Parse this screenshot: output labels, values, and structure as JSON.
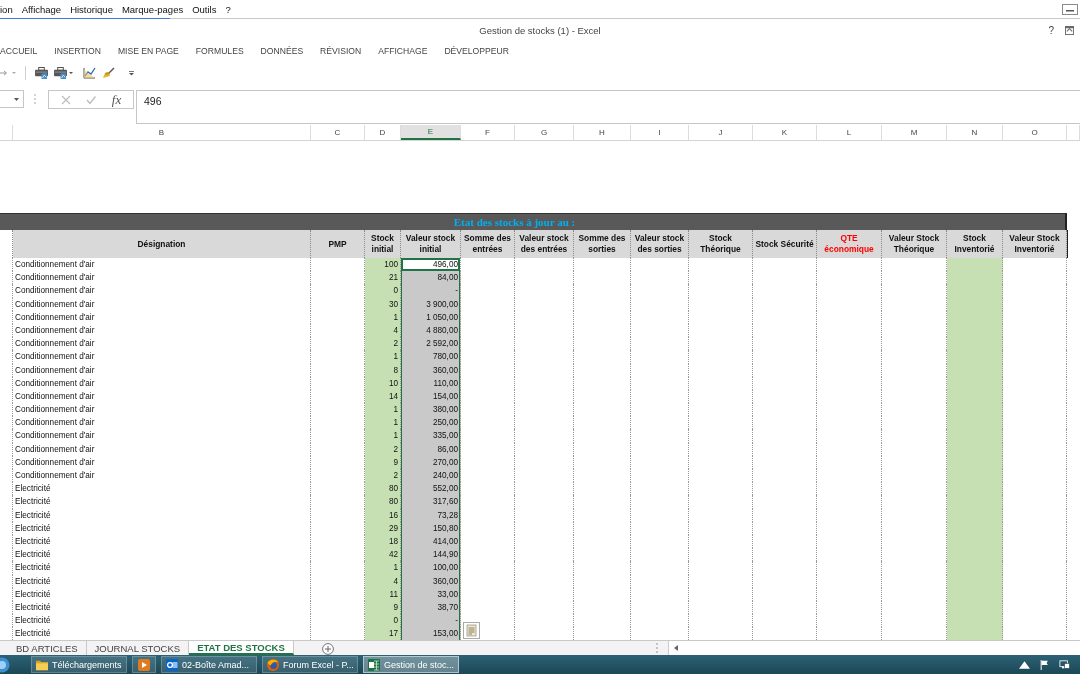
{
  "browser_menu": [
    "ion",
    "Affichage",
    "Historique",
    "Marque-pages",
    "Outils",
    "?"
  ],
  "window": {
    "title": "Gestion de stocks (1) - Excel",
    "help": "?"
  },
  "ribbon_tabs": [
    "ACCUEIL",
    "INSERTION",
    "MISE EN PAGE",
    "FORMULES",
    "DONNÉES",
    "RÉVISION",
    "AFFICHAGE",
    "DÉVELOPPEUR"
  ],
  "formula_bar": {
    "function_button": "fx",
    "value": "496"
  },
  "sheet": {
    "banner": "Etat des stocks à jour au :",
    "columns": [
      {
        "letter": "B",
        "label": "Désignation",
        "selected": false,
        "emphasized": false
      },
      {
        "letter": "C",
        "label": "PMP",
        "selected": false,
        "emphasized": false
      },
      {
        "letter": "D",
        "label": "Stock initial",
        "selected": false,
        "emphasized": false,
        "color": "#c6e0b4"
      },
      {
        "letter": "E",
        "label": "Valeur stock initial",
        "selected": true,
        "emphasized": false,
        "color": "#c9c9c9"
      },
      {
        "letter": "F",
        "label": "Somme des entrées",
        "selected": false,
        "emphasized": false
      },
      {
        "letter": "G",
        "label": "Valeur stock des entrées",
        "selected": false,
        "emphasized": false
      },
      {
        "letter": "H",
        "label": "Somme des sorties",
        "selected": false,
        "emphasized": false
      },
      {
        "letter": "I",
        "label": "Valeur stock des sorties",
        "selected": false,
        "emphasized": false
      },
      {
        "letter": "J",
        "label": "Stock Théorique",
        "selected": false,
        "emphasized": false
      },
      {
        "letter": "K",
        "label": "Stock Sécurité",
        "selected": false,
        "emphasized": false
      },
      {
        "letter": "L",
        "label": "QTE économique",
        "selected": false,
        "emphasized": true
      },
      {
        "letter": "M",
        "label": "Valeur Stock Théorique",
        "selected": false,
        "emphasized": false
      },
      {
        "letter": "N",
        "label": "Stock Inventorié",
        "selected": false,
        "emphasized": false,
        "color": "#c6e0b4"
      },
      {
        "letter": "O",
        "label": "Valeur Stock Inventorié",
        "selected": false,
        "emphasized": false
      }
    ],
    "rows": [
      {
        "designation": "Conditionnement d'air",
        "stock_initial": "100",
        "valeur_stock_initial": "496,00",
        "selected": true
      },
      {
        "designation": "Conditionnement d'air",
        "stock_initial": "21",
        "valeur_stock_initial": "84,00",
        "selected": false
      },
      {
        "designation": "Conditionnement d'air",
        "stock_initial": "0",
        "valeur_stock_initial": "-",
        "selected": false
      },
      {
        "designation": "Conditionnement d'air",
        "stock_initial": "30",
        "valeur_stock_initial": "3 900,00",
        "selected": false
      },
      {
        "designation": "Conditionnement d'air",
        "stock_initial": "1",
        "valeur_stock_initial": "1 050,00",
        "selected": false
      },
      {
        "designation": "Conditionnement d'air",
        "stock_initial": "4",
        "valeur_stock_initial": "4 880,00",
        "selected": false
      },
      {
        "designation": "Conditionnement d'air",
        "stock_initial": "2",
        "valeur_stock_initial": "2 592,00",
        "selected": false
      },
      {
        "designation": "Conditionnement d'air",
        "stock_initial": "1",
        "valeur_stock_initial": "780,00",
        "selected": false
      },
      {
        "designation": "Conditionnement d'air",
        "stock_initial": "8",
        "valeur_stock_initial": "360,00",
        "selected": false
      },
      {
        "designation": "Conditionnement d'air",
        "stock_initial": "10",
        "valeur_stock_initial": "110,00",
        "selected": false
      },
      {
        "designation": "Conditionnement d'air",
        "stock_initial": "14",
        "valeur_stock_initial": "154,00",
        "selected": false
      },
      {
        "designation": "Conditionnement d'air",
        "stock_initial": "1",
        "valeur_stock_initial": "380,00",
        "selected": false
      },
      {
        "designation": "Conditionnement d'air",
        "stock_initial": "1",
        "valeur_stock_initial": "250,00",
        "selected": false
      },
      {
        "designation": "Conditionnement d'air",
        "stock_initial": "1",
        "valeur_stock_initial": "335,00",
        "selected": false
      },
      {
        "designation": "Conditionnement d'air",
        "stock_initial": "2",
        "valeur_stock_initial": "86,00",
        "selected": false
      },
      {
        "designation": "Conditionnement d'air",
        "stock_initial": "9",
        "valeur_stock_initial": "270,00",
        "selected": false
      },
      {
        "designation": "Conditionnement d'air",
        "stock_initial": "2",
        "valeur_stock_initial": "240,00",
        "selected": false
      },
      {
        "designation": "Electricité",
        "stock_initial": "80",
        "valeur_stock_initial": "552,00",
        "selected": false
      },
      {
        "designation": "Electricité",
        "stock_initial": "80",
        "valeur_stock_initial": "317,60",
        "selected": false
      },
      {
        "designation": "Electricité",
        "stock_initial": "16",
        "valeur_stock_initial": "73,28",
        "selected": false
      },
      {
        "designation": "Electricité",
        "stock_initial": "29",
        "valeur_stock_initial": "150,80",
        "selected": false
      },
      {
        "designation": "Electricité",
        "stock_initial": "18",
        "valeur_stock_initial": "414,00",
        "selected": false
      },
      {
        "designation": "Electricité",
        "stock_initial": "42",
        "valeur_stock_initial": "144,90",
        "selected": false
      },
      {
        "designation": "Electricité",
        "stock_initial": "1",
        "valeur_stock_initial": "100,00",
        "selected": false
      },
      {
        "designation": "Electricité",
        "stock_initial": "4",
        "valeur_stock_initial": "360,00",
        "selected": false
      },
      {
        "designation": "Electricité",
        "stock_initial": "11",
        "valeur_stock_initial": "33,00",
        "selected": false
      },
      {
        "designation": "Electricité",
        "stock_initial": "9",
        "valeur_stock_initial": "38,70",
        "selected": false
      },
      {
        "designation": "Electricité",
        "stock_initial": "0",
        "valeur_stock_initial": "-",
        "selected": false
      },
      {
        "designation": "Electricité",
        "stock_initial": "17",
        "valeur_stock_initial": "153,00",
        "selected": false
      }
    ]
  },
  "sheet_tabs": [
    {
      "label": "BD ARTICLES",
      "selected": false
    },
    {
      "label": "JOURNAL STOCKS",
      "selected": false
    },
    {
      "label": "ETAT DES STOCKS",
      "selected": true
    }
  ],
  "taskbar": [
    {
      "kind": "folder",
      "label": "Téléchargements",
      "selected": false
    },
    {
      "kind": "media",
      "selected": false
    },
    {
      "kind": "mail",
      "label": "02-Boîte Amad...",
      "selected": false
    },
    {
      "kind": "browser",
      "label": "Forum Excel - P...",
      "selected": false
    },
    {
      "kind": "spreadsheet",
      "label": "Gestion de stoc...",
      "selected": true
    }
  ]
}
